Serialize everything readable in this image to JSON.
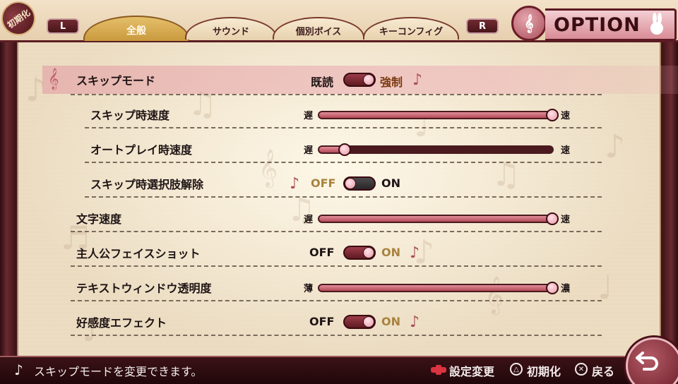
{
  "header": {
    "init_badge": "初期化",
    "shoulder_left": "L",
    "shoulder_right": "R",
    "tabs": [
      {
        "label": "全般",
        "active": true
      },
      {
        "label": "サウンド",
        "active": false
      },
      {
        "label": "個別ボイス",
        "active": false
      },
      {
        "label": "キーコンフィグ",
        "active": false
      }
    ],
    "title": "OPTION"
  },
  "settings": {
    "skip_mode": {
      "label": "スキップモード",
      "left": "既読",
      "right": "強制",
      "value": "強制"
    },
    "skip_speed": {
      "label": "スキップ時速度",
      "min": "遅",
      "max": "速",
      "level": 1.0
    },
    "auto_speed": {
      "label": "オートプレイ時速度",
      "min": "遅",
      "max": "速",
      "level": 0.11
    },
    "skip_choice": {
      "label": "スキップ時選択肢解除",
      "off": "OFF",
      "on": "ON",
      "value": "OFF"
    },
    "text_speed": {
      "label": "文字速度",
      "min": "遅",
      "max": "速",
      "level": 1.0
    },
    "face_shot": {
      "label": "主人公フェイスショット",
      "off": "OFF",
      "on": "ON",
      "value": "ON"
    },
    "window_opacity": {
      "label": "テキストウィンドウ透明度",
      "min": "薄",
      "max": "濃",
      "level": 1.0
    },
    "affinity_effect": {
      "label": "好感度エフェクト",
      "off": "OFF",
      "on": "ON",
      "value": "ON"
    }
  },
  "footer": {
    "help": "スキップモードを変更できます。",
    "change_hint": "設定変更",
    "reset_hint": "初期化",
    "back_hint": "戻る",
    "triangle_glyph": "△",
    "cross_glyph": "✕"
  },
  "colors": {
    "accent": "#a9505b",
    "frame": "#4a1d20",
    "panel": "#f1e6cf",
    "active_tab": "#c99a3e",
    "highlight_row": "#e296a0"
  }
}
